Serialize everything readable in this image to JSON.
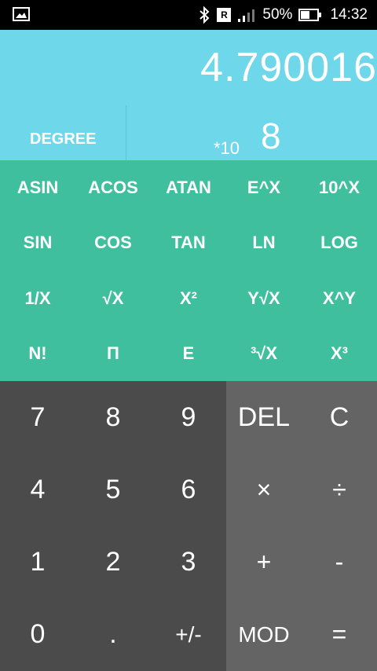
{
  "status": {
    "battery": "50%",
    "time": "14:32",
    "roaming": "R"
  },
  "display": {
    "result": "4.790016",
    "mode": "DEGREE",
    "exponent_base": "*10",
    "exponent_value": "8"
  },
  "scientific_keys": [
    "ASIN",
    "ACOS",
    "ATAN",
    "E^X",
    "10^X",
    "SIN",
    "COS",
    "TAN",
    "LN",
    "LOG",
    "1/X",
    "√X",
    "X²",
    "Y√X",
    "X^Y",
    "N!",
    "Π",
    "E",
    "³√X",
    "X³"
  ],
  "number_keys": [
    "7",
    "8",
    "9",
    "4",
    "5",
    "6",
    "1",
    "2",
    "3",
    "0",
    ".",
    "+/-"
  ],
  "operator_keys": [
    "DEL",
    "C",
    "×",
    "÷",
    "+",
    "-",
    "MOD",
    "="
  ],
  "colors": {
    "display_bg": "#6fd7ea",
    "scientific_bg": "#40bf9f",
    "numpad_bg": "#4b4b4b",
    "operator_bg": "#646464"
  }
}
